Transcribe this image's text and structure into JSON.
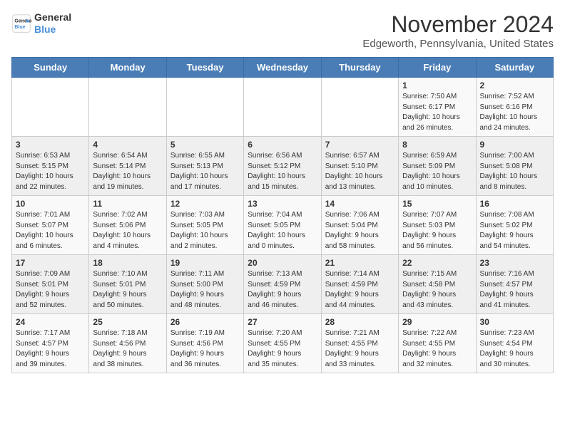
{
  "header": {
    "logo_line1": "General",
    "logo_line2": "Blue",
    "month": "November 2024",
    "location": "Edgeworth, Pennsylvania, United States"
  },
  "weekdays": [
    "Sunday",
    "Monday",
    "Tuesday",
    "Wednesday",
    "Thursday",
    "Friday",
    "Saturday"
  ],
  "weeks": [
    [
      {
        "day": "",
        "info": ""
      },
      {
        "day": "",
        "info": ""
      },
      {
        "day": "",
        "info": ""
      },
      {
        "day": "",
        "info": ""
      },
      {
        "day": "",
        "info": ""
      },
      {
        "day": "1",
        "info": "Sunrise: 7:50 AM\nSunset: 6:17 PM\nDaylight: 10 hours\nand 26 minutes."
      },
      {
        "day": "2",
        "info": "Sunrise: 7:52 AM\nSunset: 6:16 PM\nDaylight: 10 hours\nand 24 minutes."
      }
    ],
    [
      {
        "day": "3",
        "info": "Sunrise: 6:53 AM\nSunset: 5:15 PM\nDaylight: 10 hours\nand 22 minutes."
      },
      {
        "day": "4",
        "info": "Sunrise: 6:54 AM\nSunset: 5:14 PM\nDaylight: 10 hours\nand 19 minutes."
      },
      {
        "day": "5",
        "info": "Sunrise: 6:55 AM\nSunset: 5:13 PM\nDaylight: 10 hours\nand 17 minutes."
      },
      {
        "day": "6",
        "info": "Sunrise: 6:56 AM\nSunset: 5:12 PM\nDaylight: 10 hours\nand 15 minutes."
      },
      {
        "day": "7",
        "info": "Sunrise: 6:57 AM\nSunset: 5:10 PM\nDaylight: 10 hours\nand 13 minutes."
      },
      {
        "day": "8",
        "info": "Sunrise: 6:59 AM\nSunset: 5:09 PM\nDaylight: 10 hours\nand 10 minutes."
      },
      {
        "day": "9",
        "info": "Sunrise: 7:00 AM\nSunset: 5:08 PM\nDaylight: 10 hours\nand 8 minutes."
      }
    ],
    [
      {
        "day": "10",
        "info": "Sunrise: 7:01 AM\nSunset: 5:07 PM\nDaylight: 10 hours\nand 6 minutes."
      },
      {
        "day": "11",
        "info": "Sunrise: 7:02 AM\nSunset: 5:06 PM\nDaylight: 10 hours\nand 4 minutes."
      },
      {
        "day": "12",
        "info": "Sunrise: 7:03 AM\nSunset: 5:05 PM\nDaylight: 10 hours\nand 2 minutes."
      },
      {
        "day": "13",
        "info": "Sunrise: 7:04 AM\nSunset: 5:05 PM\nDaylight: 10 hours\nand 0 minutes."
      },
      {
        "day": "14",
        "info": "Sunrise: 7:06 AM\nSunset: 5:04 PM\nDaylight: 9 hours\nand 58 minutes."
      },
      {
        "day": "15",
        "info": "Sunrise: 7:07 AM\nSunset: 5:03 PM\nDaylight: 9 hours\nand 56 minutes."
      },
      {
        "day": "16",
        "info": "Sunrise: 7:08 AM\nSunset: 5:02 PM\nDaylight: 9 hours\nand 54 minutes."
      }
    ],
    [
      {
        "day": "17",
        "info": "Sunrise: 7:09 AM\nSunset: 5:01 PM\nDaylight: 9 hours\nand 52 minutes."
      },
      {
        "day": "18",
        "info": "Sunrise: 7:10 AM\nSunset: 5:01 PM\nDaylight: 9 hours\nand 50 minutes."
      },
      {
        "day": "19",
        "info": "Sunrise: 7:11 AM\nSunset: 5:00 PM\nDaylight: 9 hours\nand 48 minutes."
      },
      {
        "day": "20",
        "info": "Sunrise: 7:13 AM\nSunset: 4:59 PM\nDaylight: 9 hours\nand 46 minutes."
      },
      {
        "day": "21",
        "info": "Sunrise: 7:14 AM\nSunset: 4:59 PM\nDaylight: 9 hours\nand 44 minutes."
      },
      {
        "day": "22",
        "info": "Sunrise: 7:15 AM\nSunset: 4:58 PM\nDaylight: 9 hours\nand 43 minutes."
      },
      {
        "day": "23",
        "info": "Sunrise: 7:16 AM\nSunset: 4:57 PM\nDaylight: 9 hours\nand 41 minutes."
      }
    ],
    [
      {
        "day": "24",
        "info": "Sunrise: 7:17 AM\nSunset: 4:57 PM\nDaylight: 9 hours\nand 39 minutes."
      },
      {
        "day": "25",
        "info": "Sunrise: 7:18 AM\nSunset: 4:56 PM\nDaylight: 9 hours\nand 38 minutes."
      },
      {
        "day": "26",
        "info": "Sunrise: 7:19 AM\nSunset: 4:56 PM\nDaylight: 9 hours\nand 36 minutes."
      },
      {
        "day": "27",
        "info": "Sunrise: 7:20 AM\nSunset: 4:55 PM\nDaylight: 9 hours\nand 35 minutes."
      },
      {
        "day": "28",
        "info": "Sunrise: 7:21 AM\nSunset: 4:55 PM\nDaylight: 9 hours\nand 33 minutes."
      },
      {
        "day": "29",
        "info": "Sunrise: 7:22 AM\nSunset: 4:55 PM\nDaylight: 9 hours\nand 32 minutes."
      },
      {
        "day": "30",
        "info": "Sunrise: 7:23 AM\nSunset: 4:54 PM\nDaylight: 9 hours\nand 30 minutes."
      }
    ]
  ]
}
